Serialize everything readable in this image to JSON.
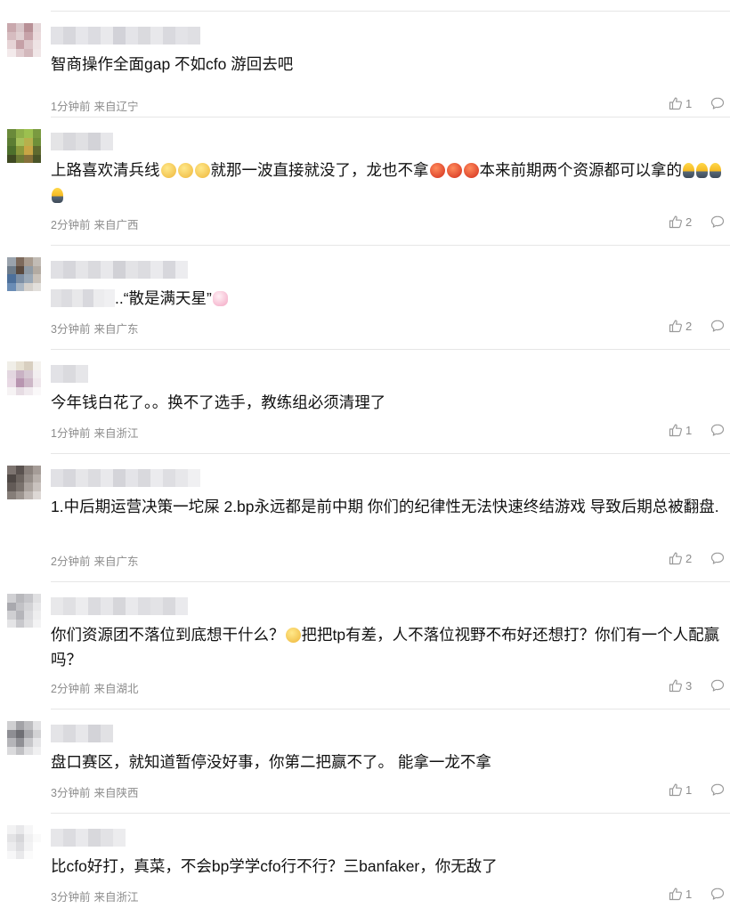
{
  "comments": [
    {
      "text_parts": [
        {
          "t": "智商操作全面gap 不如cfo 游回去吧"
        }
      ],
      "time": "1分钟前",
      "source": "来自辽宁",
      "likes": "1",
      "avatar": [
        "#c9a8ad",
        "#d8c5c8",
        "#b89096",
        "#e5d6d8",
        "#d6bcc0",
        "#e0cfd1",
        "#c7a3a9",
        "#ead9db",
        "#e6d4d6",
        "#c5a0a6",
        "#dcc6c9",
        "#eee3e4",
        "#f3eaeb",
        "#e1cdd0",
        "#d3b8bc",
        "#f0e6e7"
      ],
      "name_blocks": [
        "#e2e2e6",
        "#d7d7dc",
        "#e6e6ea",
        "#dcdce1",
        "#e9e9ec",
        "#d2d2d8",
        "#e4e4e8",
        "#dadade",
        "#e8e8eb",
        "#d9d9de",
        "#e3e3e7",
        "#dfdfe3"
      ]
    },
    {
      "text_parts": [
        {
          "t": "上路喜欢清兵线"
        },
        {
          "e": "smile"
        },
        {
          "e": "smile"
        },
        {
          "e": "smile"
        },
        {
          "t": "就那一波直接就没了，龙也不拿"
        },
        {
          "e": "red"
        },
        {
          "e": "red"
        },
        {
          "e": "red"
        },
        {
          "t": "本来前期两个资源都可以拿的"
        },
        {
          "e": "bulb"
        },
        {
          "e": "bulb"
        },
        {
          "e": "bulb"
        },
        {
          "e": "bulb"
        }
      ],
      "time": "2分钟前",
      "source": "来自广西",
      "likes": "2",
      "avatar": [
        "#6a8a3a",
        "#8fb04a",
        "#9cc04f",
        "#7a9a40",
        "#5c7d33",
        "#a5c05a",
        "#b7b04c",
        "#6f8f39",
        "#4d6f2c",
        "#8b9a3c",
        "#c8a545",
        "#5f6a2f",
        "#3f4a22",
        "#6d7a35",
        "#86703a",
        "#4a5428"
      ],
      "name_blocks": [
        "#e4e4e6",
        "#d8d8dc",
        "#e0e0e3",
        "#d3d3d8",
        "#e7e7ea"
      ]
    },
    {
      "text_parts": [
        {
          "blur": [
            "#e3e3e6",
            "#dcdce0",
            "#e8e8ea",
            "#d8d8dd",
            "#ececee",
            "#f0f0f2"
          ]
        },
        {
          "t": "..“散是满天星”"
        },
        {
          "e": "pink"
        }
      ],
      "time": "3分钟前",
      "source": "来自广东",
      "likes": "2",
      "avatar": [
        "#9aa3ad",
        "#7d6a5c",
        "#a89b8f",
        "#c2bcb5",
        "#6e7c8a",
        "#5a4a3f",
        "#8f9aa4",
        "#b3aba2",
        "#4c6f9a",
        "#7d8fa4",
        "#9aa8b6",
        "#c9c2ba",
        "#6a8cb5",
        "#aab6c3",
        "#d4d0cb",
        "#e2dfdb"
      ],
      "name_blocks": [
        "#e0e0e4",
        "#d6d6db",
        "#e5e5e8",
        "#dadade",
        "#e8e8eb",
        "#d1d1d6",
        "#e3e3e6",
        "#dcdce0",
        "#eaeaed",
        "#d7d7dc",
        "#ececef"
      ]
    },
    {
      "text_parts": [
        {
          "t": "今年钱白花了。。换不了选手，教练组必须清理了"
        }
      ],
      "time": "1分钟前",
      "source": "来自浙江",
      "likes": "1",
      "avatar": [
        "#f0eee8",
        "#e6e0d2",
        "#d8cfc0",
        "#f4f2ee",
        "#e3d7e0",
        "#c9b2c4",
        "#d6c8d2",
        "#f2eef0",
        "#e8d9e4",
        "#b895b0",
        "#cdb7c7",
        "#efe7ec",
        "#f6f3f4",
        "#e6dce3",
        "#f0eaee",
        "#faf8f9"
      ],
      "name_blocks": [
        "#e2e2e6",
        "#dadade",
        "#e6e6e9"
      ]
    },
    {
      "text_parts": [
        {
          "t": "1.中后期运营决策一坨屎 2.bp永远都是前中期 你们的纪律性无法快速终结游戏 导致后期总被翻盘."
        }
      ],
      "time": "2分钟前",
      "source": "来自广东",
      "likes": "2",
      "avatar": [
        "#7d7470",
        "#5a524f",
        "#8a817c",
        "#a59c97",
        "#4f4845",
        "#6d6560",
        "#968e89",
        "#b8b0ab",
        "#635b57",
        "#7a726d",
        "#aaa29d",
        "#c9c2be",
        "#857d78",
        "#9c948f",
        "#bfb8b4",
        "#ddd8d5"
      ],
      "name_blocks": [
        "#e1e1e5",
        "#d7d7dc",
        "#e6e6e9",
        "#dcdce0",
        "#e9e9ec",
        "#d4d4d9",
        "#e4e4e8",
        "#d9d9dd",
        "#ebebee",
        "#dedee2",
        "#e7e7ea",
        "#f0f0f2"
      ]
    },
    {
      "text_parts": [
        {
          "t": "你们资源团不落位到底想干什么？"
        },
        {
          "e": "smile"
        },
        {
          "t": "把把tp有差，人不落位视野不布好还想打？你们有一个人配赢吗？"
        }
      ],
      "time": "2分钟前",
      "source": "来自湖北",
      "likes": "3",
      "avatar": [
        "#d0d0d3",
        "#b8b8bc",
        "#c6c6ca",
        "#e0e0e2",
        "#a9a9ae",
        "#c2c2c6",
        "#d3d3d6",
        "#e8e8ea",
        "#cfcfd2",
        "#b5b5ba",
        "#dadadd",
        "#eeeeef",
        "#e4e4e6",
        "#c8c8cc",
        "#dfdfe1",
        "#f3f3f4"
      ],
      "name_blocks": [
        "#e8e8ea",
        "#e0e0e3",
        "#ececee",
        "#dbdbdf",
        "#e6e6e9",
        "#d6d6da",
        "#e9e9ec",
        "#dedee2",
        "#e3e3e6",
        "#d9d9dd",
        "#eaeaed"
      ]
    },
    {
      "text_parts": [
        {
          "t": "盘口赛区，就知道暂停没好事，你第二把赢不了。 能拿一龙不拿"
        }
      ],
      "time": "3分钟前",
      "source": "来自陕西",
      "likes": "1",
      "avatar": [
        "#cfcfd1",
        "#a3a3a7",
        "#bdbdc0",
        "#e2e2e4",
        "#8e8e93",
        "#6f6f74",
        "#a8a8ac",
        "#d2d2d4",
        "#b5b5b9",
        "#909095",
        "#c7c7ca",
        "#e6e6e8",
        "#dadadc",
        "#c1c1c4",
        "#e0e0e2",
        "#f0f0f1"
      ],
      "name_blocks": [
        "#e4e4e7",
        "#dadade",
        "#e7e7ea",
        "#d3d3d8",
        "#e1e1e4"
      ]
    },
    {
      "text_parts": [
        {
          "t": "比cfo好打，真菜，不会bp学学cfo行不行？三banfaker，你无敌了"
        }
      ],
      "time": "3分钟前",
      "source": "来自浙江",
      "likes": "1",
      "avatar": [
        "#f2f2f3",
        "#e8e8ea",
        "#f6f6f7",
        "#ffffff",
        "#e3e3e5",
        "#d6d6d9",
        "#f0f0f1",
        "#fafafa",
        "#ececee",
        "#dedee1",
        "#f3f3f4",
        "#ffffff",
        "#f7f7f8",
        "#e9e9eb",
        "#fbfbfb",
        "#ffffff"
      ],
      "name_blocks": [
        "#e6e6e9",
        "#dcdce0",
        "#e9e9ec",
        "#d8d8dc",
        "#e2e2e5",
        "#ececee"
      ]
    }
  ],
  "colors": {
    "text": "#111111",
    "meta": "#8c8c8c",
    "divider": "#e6e6e6",
    "icon": "#9a9a9a"
  },
  "icons": {
    "like": "thumbs-up-icon",
    "reply": "speech-bubble-icon"
  }
}
